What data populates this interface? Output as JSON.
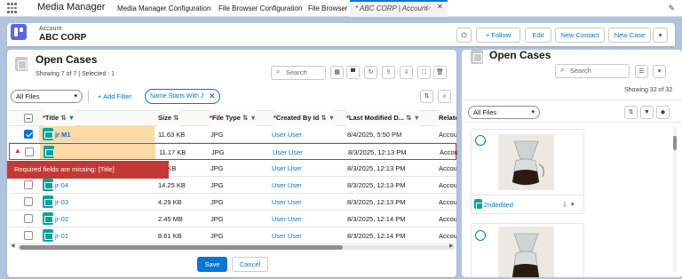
{
  "topnav": {
    "app_name": "Media Manager",
    "tabs": [
      "Media Manager Configuration",
      "File Browser Configuration",
      "File Browser"
    ],
    "active_tab": "* ABC CORP | Account"
  },
  "header": {
    "type": "Account",
    "name": "ABC CORP",
    "follow": "Follow",
    "edit": "Edit",
    "new_contact": "New Contact",
    "new_case": "New Case"
  },
  "main": {
    "title": "Open Cases",
    "summary": "Showing 7 of 7 | Selected : 1",
    "search_placeholder": "Search",
    "filter_select": "All Files",
    "add_filter": "Add Filter",
    "filter_pill": "Name Starts With J",
    "columns": [
      "Title",
      "Size",
      "File Type",
      "Created By Id",
      "Last Modified D...",
      "Relate"
    ],
    "rows": [
      {
        "title": "jr M1",
        "size": "11.63 KB",
        "type": "JPG",
        "created": "User User",
        "modified": "8/4/2025, 5:50 PM",
        "related": "Accou"
      },
      {
        "title": "",
        "size": "11.17 KB",
        "type": "JPG",
        "created": "User User",
        "modified": "8/3/2025, 12:13 PM",
        "related": "Accou"
      },
      {
        "title": "",
        "size": ".9 KB",
        "type": "JPG",
        "created": "User User",
        "modified": "8/3/2025, 12:13 PM",
        "related": "Accou"
      },
      {
        "title": "jr-04",
        "size": "14.25 KB",
        "type": "JPG",
        "created": "User User",
        "modified": "8/3/2025, 12:13 PM",
        "related": "Accou"
      },
      {
        "title": "jr-03",
        "size": "4.29 KB",
        "type": "JPG",
        "created": "User User",
        "modified": "8/3/2025, 12:13 PM",
        "related": "Accou"
      },
      {
        "title": "jr-02",
        "size": "2.45 MB",
        "type": "JPG",
        "created": "User User",
        "modified": "8/3/2025, 12:14 PM",
        "related": "Accou"
      },
      {
        "title": "jr-01",
        "size": "8.61 KB",
        "type": "JPG",
        "created": "User User",
        "modified": "8/3/2025, 12:14 PM",
        "related": "Accou"
      }
    ],
    "error": "Required fields are missing: [Title]",
    "save": "Save",
    "cancel": "Cancel"
  },
  "side": {
    "title": "Open Cases",
    "search_placeholder": "Search",
    "summary": "Showing 32 of 32",
    "filter_select": "All Files",
    "card1_name": "2ndedited"
  }
}
